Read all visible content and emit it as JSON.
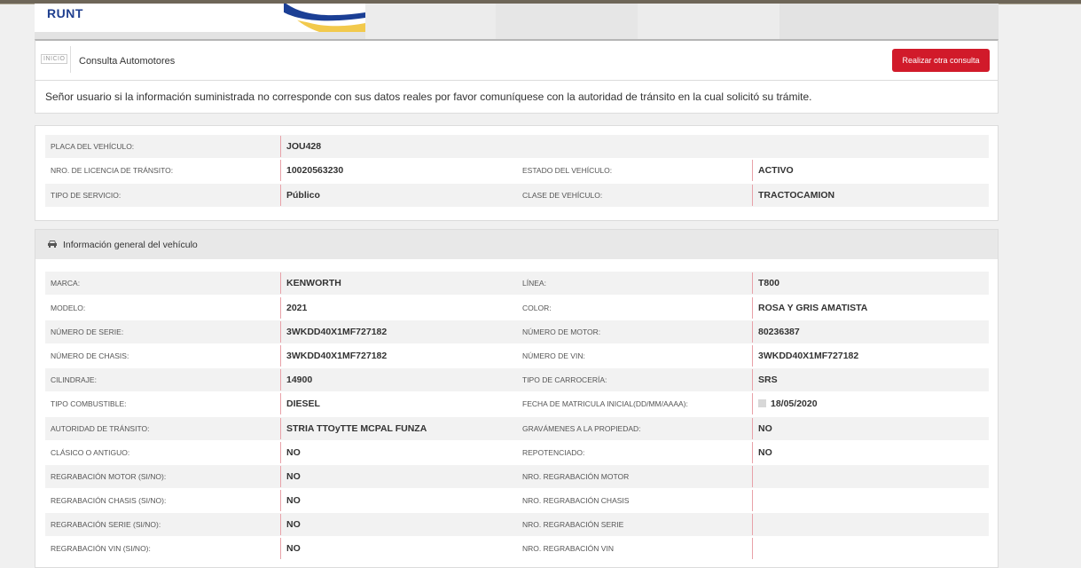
{
  "header": {
    "logo_text": "RUNT",
    "inicio_label": "INICIO",
    "title": "Consulta Automotores",
    "button_label": "Realizar otra consulta"
  },
  "notice": "Señor usuario si la información suministrada no corresponde con sus datos reales por favor comuníquese con la autoridad de tránsito en la cual solicitó su trámite.",
  "summary": {
    "placa_label": "PLACA DEL VEHÍCULO:",
    "placa_value": "JOU428",
    "licencia_label": "NRO. DE LICENCIA DE TRÁNSITO:",
    "licencia_value": "10020563230",
    "estado_label": "ESTADO DEL VEHÍCULO:",
    "estado_value": "ACTIVO",
    "servicio_label": "TIPO DE SERVICIO:",
    "servicio_value": "Público",
    "clase_label": "CLASE DE VEHÍCULO:",
    "clase_value": "TRACTOCAMION"
  },
  "general": {
    "heading": "Información general del vehículo",
    "rows": [
      {
        "label_left": "MARCA:",
        "value_left": "KENWORTH",
        "label_right": "LÍNEA:",
        "value_right": "T800"
      },
      {
        "label_left": "MODELO:",
        "value_left": "2021",
        "label_right": "COLOR:",
        "value_right": "ROSA Y GRIS AMATISTA"
      },
      {
        "label_left": "NÚMERO DE SERIE:",
        "value_left": "3WKDD40X1MF727182",
        "label_right": "NÚMERO DE MOTOR:",
        "value_right": "80236387"
      },
      {
        "label_left": "NÚMERO DE CHASIS:",
        "value_left": "3WKDD40X1MF727182",
        "label_right": "NÚMERO DE VIN:",
        "value_right": "3WKDD40X1MF727182"
      },
      {
        "label_left": "CILINDRAJE:",
        "value_left": "14900",
        "label_right": "TIPO DE CARROCERÍA:",
        "value_right": "SRS"
      },
      {
        "label_left": "TIPO COMBUSTIBLE:",
        "value_left": "DIESEL",
        "label_right": "FECHA DE MATRICULA INICIAL(DD/MM/AAAA):",
        "value_right": "18/05/2020"
      },
      {
        "label_left": "AUTORIDAD DE TRÁNSITO:",
        "value_left": "STRIA TTOyTTE MCPAL FUNZA",
        "label_right": "GRAVÁMENES A LA PROPIEDAD:",
        "value_right": "NO"
      },
      {
        "label_left": "CLÁSICO O ANTIGUO:",
        "value_left": "NO",
        "label_right": "REPOTENCIADO:",
        "value_right": "NO"
      },
      {
        "label_left": "REGRABACIÓN MOTOR (SI/NO):",
        "value_left": "NO",
        "label_right": "NRO. REGRABACIÓN MOTOR",
        "value_right": ""
      },
      {
        "label_left": "REGRABACIÓN CHASIS (SI/NO):",
        "value_left": "NO",
        "label_right": "NRO. REGRABACIÓN CHASIS",
        "value_right": ""
      },
      {
        "label_left": "REGRABACIÓN SERIE (SI/NO):",
        "value_left": "NO",
        "label_right": "NRO. REGRABACIÓN SERIE",
        "value_right": ""
      },
      {
        "label_left": "REGRABACIÓN VIN (SI/NO):",
        "value_left": "NO",
        "label_right": "NRO. REGRABACIÓN VIN",
        "value_right": ""
      }
    ]
  },
  "colors": {
    "accent": "#d11a2a",
    "logo_blue": "#1f3f8f",
    "row_shade": "#f2f2f2",
    "value_bar": "#e8a1a8"
  }
}
